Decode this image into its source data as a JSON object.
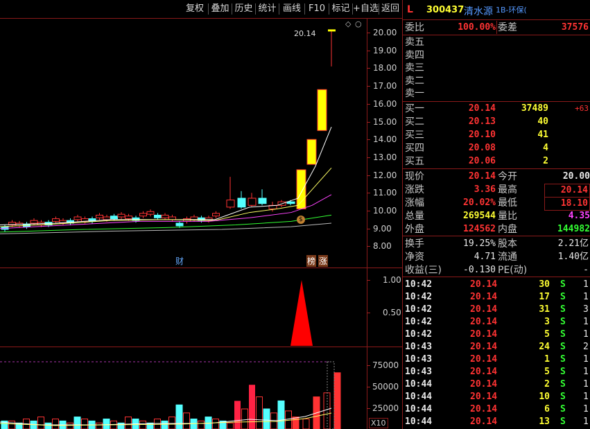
{
  "toolbar": {
    "buttons": [
      "复权",
      "叠加",
      "历史",
      "统计",
      "画线",
      "F10",
      "标记",
      "+自选",
      "返回"
    ]
  },
  "header": {
    "flag": "L",
    "code": "300437",
    "name": "清水源",
    "tags": "1B-环保("
  },
  "chart": {
    "peak_label": "20.14",
    "price_axis": [
      "20.00",
      "19.00",
      "18.00",
      "17.00",
      "16.00",
      "15.00",
      "14.00",
      "13.00",
      "12.00",
      "11.00",
      "10.00",
      "9.00",
      "8.00"
    ],
    "indicator_axis": [
      "1.00",
      "0.50"
    ],
    "volume_axis": [
      "75000",
      "50000",
      "25000"
    ],
    "volume_unit": "X10",
    "markers": {
      "cai": "财",
      "bang": "榜",
      "zhang": "涨",
      "coin": "$"
    },
    "colors": {
      "up": "#ff3333",
      "down": "#54ffff",
      "limit": "#ffff00",
      "ma5": "#ffffff",
      "ma10": "#ffff66",
      "ma20": "#ff44ff",
      "ma60": "#33ff33",
      "grid": "#8b1a1a"
    }
  },
  "quote": {
    "weibi_label": "委比",
    "weibi": "100.00%",
    "weicha_label": "委差",
    "weicha": "37576",
    "sell": [
      {
        "label": "卖五"
      },
      {
        "label": "卖四"
      },
      {
        "label": "卖三"
      },
      {
        "label": "卖二"
      },
      {
        "label": "卖一"
      }
    ],
    "buy": [
      {
        "label": "买一",
        "price": "20.14",
        "vol": "37489",
        "chg": "+63"
      },
      {
        "label": "买二",
        "price": "20.13",
        "vol": "40",
        "chg": ""
      },
      {
        "label": "买三",
        "price": "20.10",
        "vol": "41",
        "chg": ""
      },
      {
        "label": "买四",
        "price": "20.08",
        "vol": "4",
        "chg": ""
      },
      {
        "label": "买五",
        "price": "20.06",
        "vol": "2",
        "chg": ""
      }
    ],
    "stats": [
      {
        "l1": "现价",
        "v1": "20.14",
        "l2": "今开",
        "v2": "20.00"
      },
      {
        "l1": "涨跌",
        "v1": "3.36",
        "l2": "最高",
        "v2": "20.14"
      },
      {
        "l1": "涨幅",
        "v1": "20.02%",
        "l2": "最低",
        "v2": "18.10"
      },
      {
        "l1": "总量",
        "v1": "269544",
        "l2": "量比",
        "v2": "4.35"
      },
      {
        "l1": "外盘",
        "v1": "124562",
        "l2": "内盘",
        "v2": "144982"
      }
    ],
    "info": [
      {
        "l1": "换手",
        "v1": "19.25%",
        "l2": "股本",
        "v2": "2.21亿"
      },
      {
        "l1": "净资",
        "v1": "4.71",
        "l2": "流通",
        "v2": "1.40亿"
      },
      {
        "l1": "收益(三)",
        "v1": "-0.130",
        "l2": "PE(动)",
        "v2": "-"
      }
    ],
    "ticks": [
      {
        "time": "10:42",
        "price": "20.14",
        "vol": "30",
        "side": "S",
        "n": "1"
      },
      {
        "time": "10:42",
        "price": "20.14",
        "vol": "17",
        "side": "S",
        "n": "1"
      },
      {
        "time": "10:42",
        "price": "20.14",
        "vol": "31",
        "side": "S",
        "n": "3"
      },
      {
        "time": "10:42",
        "price": "20.14",
        "vol": "3",
        "side": "S",
        "n": "1"
      },
      {
        "time": "10:42",
        "price": "20.14",
        "vol": "5",
        "side": "S",
        "n": "1"
      },
      {
        "time": "10:43",
        "price": "20.14",
        "vol": "24",
        "side": "S",
        "n": "2"
      },
      {
        "time": "10:43",
        "price": "20.14",
        "vol": "1",
        "side": "S",
        "n": "1"
      },
      {
        "time": "10:43",
        "price": "20.14",
        "vol": "5",
        "side": "S",
        "n": "1"
      },
      {
        "time": "10:44",
        "price": "20.14",
        "vol": "2",
        "side": "S",
        "n": "1"
      },
      {
        "time": "10:44",
        "price": "20.14",
        "vol": "10",
        "side": "S",
        "n": "1"
      },
      {
        "time": "10:44",
        "price": "20.14",
        "vol": "6",
        "side": "S",
        "n": "1"
      },
      {
        "time": "10:44",
        "price": "20.14",
        "vol": "13",
        "side": "S",
        "n": "1"
      }
    ]
  }
}
